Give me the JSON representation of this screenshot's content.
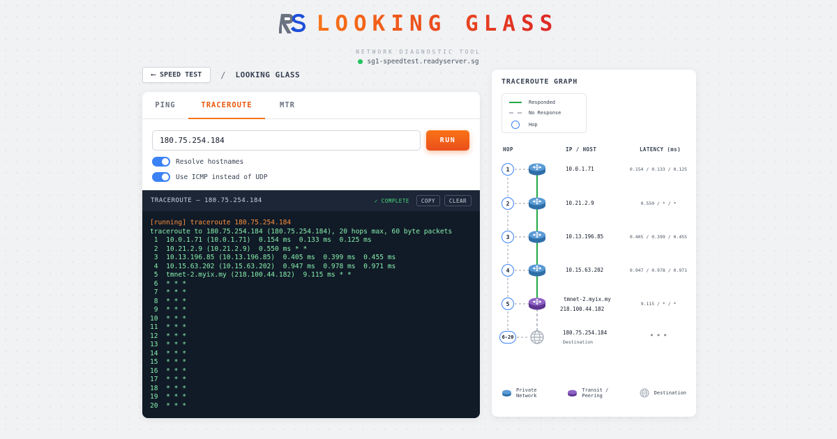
{
  "brand": {
    "logo_text": "RS",
    "title": "LOOKING GLASS",
    "subtitle": "NETWORK DIAGNOSTIC TOOL",
    "host": "sg1-speedtest.readyserver.sg"
  },
  "breadcrumb": {
    "back_label": "SPEED TEST",
    "separator": "/",
    "current": "LOOKING GLASS"
  },
  "tabs": [
    {
      "label": "PING"
    },
    {
      "label": "TRACEROUTE",
      "active": true
    },
    {
      "label": "MTR"
    }
  ],
  "form": {
    "target_value": "180.75.254.184",
    "run_label": "RUN",
    "options": [
      {
        "label": "Resolve hostnames",
        "enabled": true
      },
      {
        "label": "Use ICMP instead of UDP",
        "enabled": true
      }
    ]
  },
  "terminal": {
    "title": "TRACEROUTE — 180.75.254.184",
    "status": "✓ COMPLETE",
    "copy_label": "COPY",
    "clear_label": "CLEAR",
    "running_line": "[running] traceroute 180.75.254.184",
    "lines": [
      "traceroute to 180.75.254.184 (180.75.254.184), 20 hops max, 60 byte packets",
      " 1  10.0.1.71 (10.0.1.71)  0.154 ms  0.133 ms  0.125 ms",
      " 2  10.21.2.9 (10.21.2.9)  0.550 ms * *",
      " 3  10.13.196.85 (10.13.196.85)  0.405 ms  0.399 ms  0.455 ms",
      " 4  10.15.63.202 (10.15.63.202)  0.947 ms  0.978 ms  0.971 ms",
      " 5  tmnet-2.myix.my (218.100.44.182)  9.115 ms * *",
      " 6  * * *",
      " 7  * * *",
      " 8  * * *",
      " 9  * * *",
      "10  * * *",
      "11  * * *",
      "12  * * *",
      "13  * * *",
      "14  * * *",
      "15  * * *",
      "16  * * *",
      "17  * * *",
      "18  * * *",
      "19  * * *",
      "20  * * *"
    ]
  },
  "graph": {
    "title": "TRACEROUTE GRAPH",
    "legend": {
      "responded": "Responded",
      "no_response": "No Response",
      "hop": "Hop"
    },
    "columns": {
      "hop": "HOP",
      "ip": "IP / HOST",
      "latency": "LATENCY (ms)"
    },
    "hops": [
      {
        "num": "1",
        "ip": "10.0.1.71",
        "sub": "",
        "latency": "0.154 / 0.133 / 0.125",
        "kind": "private"
      },
      {
        "num": "2",
        "ip": "10.21.2.9",
        "sub": "",
        "latency": "0.550 / * / *",
        "kind": "private"
      },
      {
        "num": "3",
        "ip": "10.13.196.85",
        "sub": "",
        "latency": "0.405 / 0.399 / 0.455",
        "kind": "private"
      },
      {
        "num": "4",
        "ip": "10.15.63.202",
        "sub": "",
        "latency": "0.947 / 0.978 / 0.971",
        "kind": "private"
      },
      {
        "num": "5",
        "ip": "tmnet-2.myix.my",
        "sub": "218.100.44.182",
        "latency": "9.115 / * / *",
        "kind": "transit"
      },
      {
        "num": "6-20",
        "ip": "180.75.254.184",
        "sub": "Destination",
        "latency": "* * *",
        "kind": "destination"
      }
    ],
    "bottom_legend": {
      "private": "Private Network",
      "transit": "Transit / Peering",
      "destination": "Destination"
    },
    "colors": {
      "responded": "#22a845",
      "no_response": "#b8bec7",
      "private": "#3b82c4",
      "transit": "#7c4bb0",
      "hop_border": "#3b82f6"
    }
  }
}
